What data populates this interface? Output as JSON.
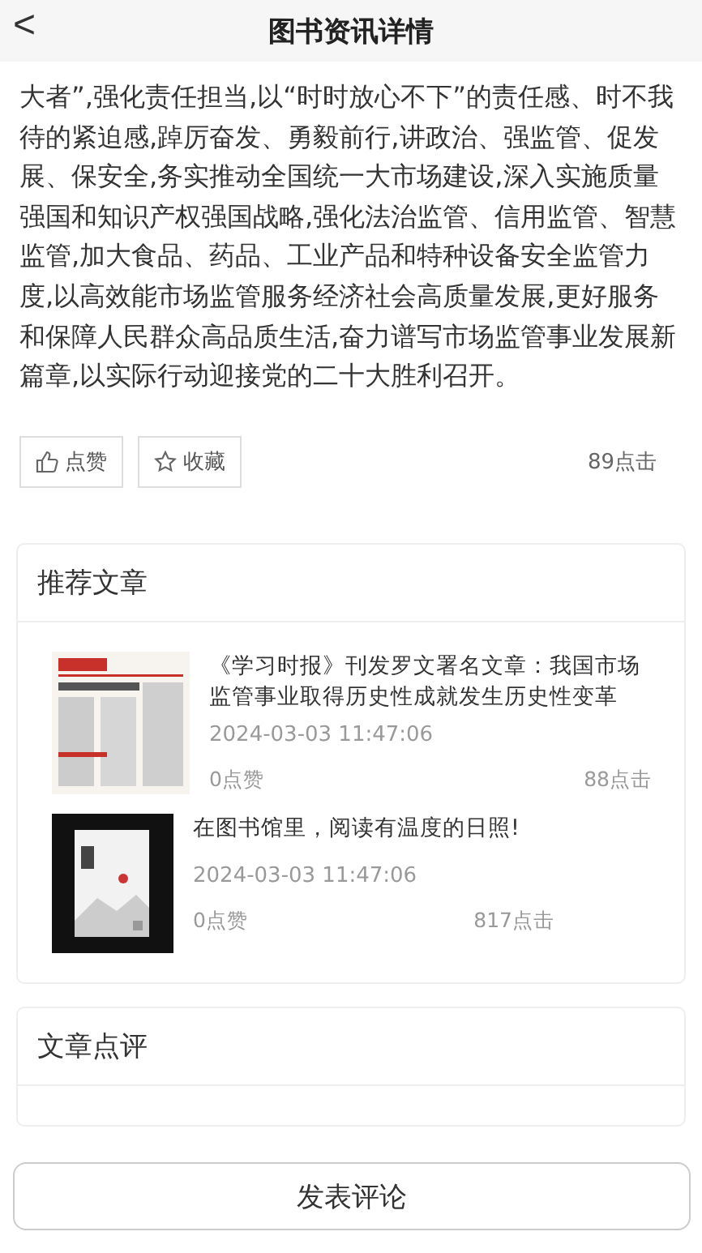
{
  "header": {
    "back": "<",
    "title": "图书资讯详情"
  },
  "article": {
    "body": "大者”,强化责任担当,以“时时放心不下”的责任感、时不我待的紧迫感,踔厉奋发、勇毅前行,讲政治、强监管、促发展、保安全,务实推动全国统一大市场建设,深入实施质量强国和知识产权强国战略,强化法治监管、信用监管、智慧监管,加大食品、药品、工业产品和特种设备安全监管力度,以高效能市场监管服务经济社会高质量发展,更好服务和保障人民群众高品质生活,奋力谱写市场监管事业发展新篇章,以实际行动迎接党的二十大胜利召开。"
  },
  "actions": {
    "like": "点赞",
    "favorite": "收藏",
    "clicks": "89点击"
  },
  "recommended": {
    "title": "推荐文章",
    "items": [
      {
        "kind": "newspaper",
        "title": "《学习时报》刊发罗文署名文章：我国市场监管事业取得历史性成就发生历史性变革",
        "date": "2024-03-03 11:47:06",
        "likes": "0点赞",
        "clicks": "88点击"
      },
      {
        "kind": "book",
        "title": "在图书馆里，阅读有温度的日照!",
        "date": "2024-03-03 11:47:06",
        "likes": "0点赞",
        "clicks": "817点击"
      }
    ]
  },
  "comments": {
    "title": "文章点评"
  },
  "submit": "发表评论"
}
